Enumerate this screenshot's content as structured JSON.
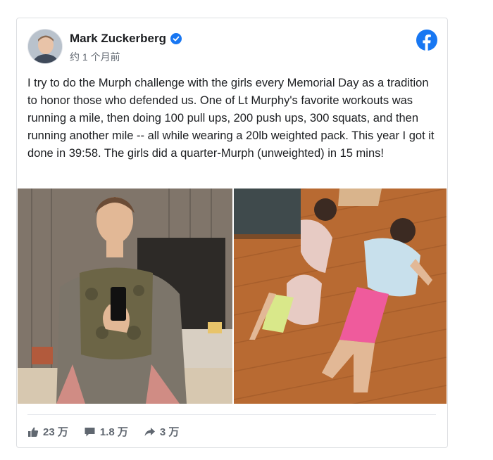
{
  "post": {
    "author": "Mark Zuckerberg",
    "timestamp": "约 1 个月前",
    "text": "I try to do the Murph challenge with the girls every Memorial Day as a tradition to honor those who defended us. One of Lt Murphy's favorite workouts was running a mile, then doing 100 pull ups, 200 push ups, 300 squats, and then running another mile -- all while wearing a 20lb weighted pack. This year I got it done in 39:58. The girls did a quarter-Murph (unweighted) in 15 mins!"
  },
  "icons": {
    "avatar": "profile-photo",
    "verified": "verified-badge-icon",
    "platform": "facebook-logo-icon",
    "like": "thumbs-up-icon",
    "comment": "comment-bubble-icon",
    "share": "share-arrow-icon"
  },
  "photos": {
    "left": "selfie-with-weighted-vest",
    "right": "two-girls-doing-push-ups"
  },
  "stats": {
    "likes": "23 万",
    "comments": "1.8 万",
    "shares": "3 万"
  },
  "colors": {
    "facebook_blue": "#1877f2",
    "text": "#1c1e21",
    "muted": "#606770",
    "border": "#dddfe2"
  }
}
